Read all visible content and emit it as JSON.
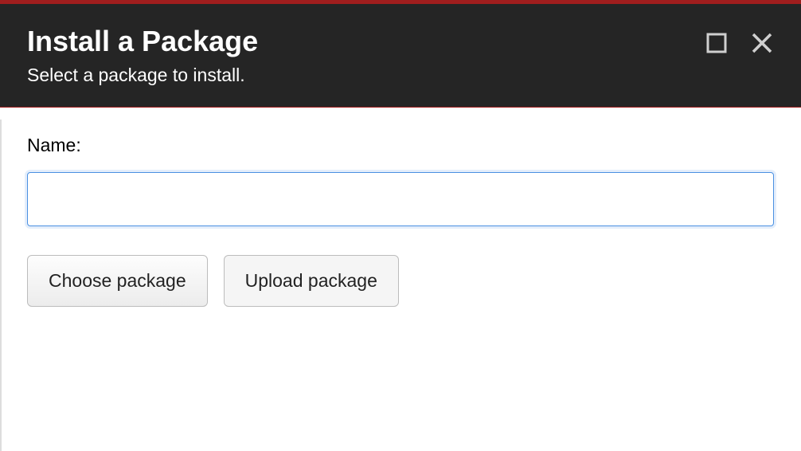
{
  "header": {
    "title": "Install a Package",
    "subtitle": "Select a package to install."
  },
  "form": {
    "name_label": "Name:",
    "name_value": "",
    "choose_label": "Choose package",
    "upload_label": "Upload package"
  }
}
